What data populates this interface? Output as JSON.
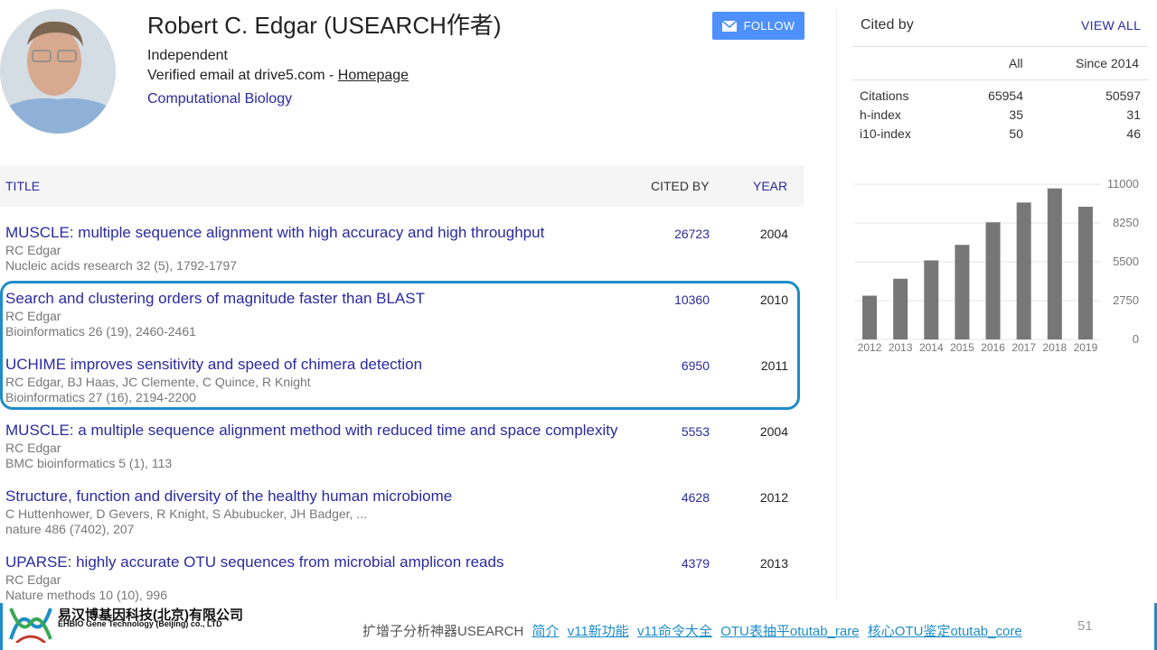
{
  "profile": {
    "name": "Robert C. Edgar (USEARCH作者)",
    "affiliation": "Independent",
    "email_prefix": "Verified email at drive5.com -",
    "homepage_label": "Homepage",
    "interest": "Computational Biology",
    "follow_label": "FOLLOW"
  },
  "table": {
    "col_title": "TITLE",
    "col_cited": "CITED BY",
    "col_year": "YEAR",
    "rows": [
      {
        "title": "MUSCLE: multiple sequence alignment with high accuracy and high throughput",
        "authors": "RC Edgar",
        "venue": "Nucleic acids research 32 (5), 1792-1797",
        "cited": "26723",
        "year": "2004"
      },
      {
        "title": "Search and clustering orders of magnitude faster than BLAST",
        "authors": "RC Edgar",
        "venue": "Bioinformatics 26 (19), 2460-2461",
        "cited": "10360",
        "year": "2010"
      },
      {
        "title": "UCHIME improves sensitivity and speed of chimera detection",
        "authors": "RC Edgar, BJ Haas, JC Clemente, C Quince, R Knight",
        "venue": "Bioinformatics 27 (16), 2194-2200",
        "cited": "6950",
        "year": "2011"
      },
      {
        "title": "MUSCLE: a multiple sequence alignment method with reduced time and space complexity",
        "authors": "RC Edgar",
        "venue": "BMC bioinformatics 5 (1), 113",
        "cited": "5553",
        "year": "2004"
      },
      {
        "title": "Structure, function and diversity of the healthy human microbiome",
        "authors": "C Huttenhower, D Gevers, R Knight, S Abubucker, JH Badger, ...",
        "venue": "nature 486 (7402), 207",
        "cited": "4628",
        "year": "2012"
      },
      {
        "title": "UPARSE: highly accurate OTU sequences from microbial amplicon reads",
        "authors": "RC Edgar",
        "venue": "Nature methods 10 (10), 996",
        "cited": "4379",
        "year": "2013"
      }
    ]
  },
  "cited_by": {
    "title": "Cited by",
    "view_all": "VIEW ALL",
    "col_all": "All",
    "col_since": "Since 2014",
    "stats": [
      {
        "label": "Citations",
        "all": "65954",
        "since": "50597"
      },
      {
        "label": "h-index",
        "all": "35",
        "since": "31"
      },
      {
        "label": "i10-index",
        "all": "50",
        "since": "46"
      }
    ]
  },
  "chart_data": {
    "type": "bar",
    "categories": [
      "2012",
      "2013",
      "2014",
      "2015",
      "2016",
      "2017",
      "2018",
      "2019"
    ],
    "values": [
      3100,
      4300,
      5600,
      6700,
      8300,
      9700,
      10700,
      9400
    ],
    "ylim": [
      0,
      11000
    ],
    "yticks": [
      "11000",
      "8250",
      "5500",
      "2750",
      "0"
    ],
    "bar_color": "#777777",
    "grid": true
  },
  "footer": {
    "company_cn": "易汉博基因科技(北京)有限公司",
    "company_en": "EHBIO Gene Technology (Beijing) co., LTD",
    "lead_text": "扩增子分析神器USEARCH",
    "links": [
      "简介",
      "v11新功能",
      "v11命令大全",
      "OTU表抽平otutab_rare",
      "核心OTU鉴定otutab_core"
    ],
    "page_number": "51"
  },
  "colors": {
    "link": "#2a2aa0",
    "accent": "#1e8dc8",
    "follow_button": "#4d90fe"
  }
}
